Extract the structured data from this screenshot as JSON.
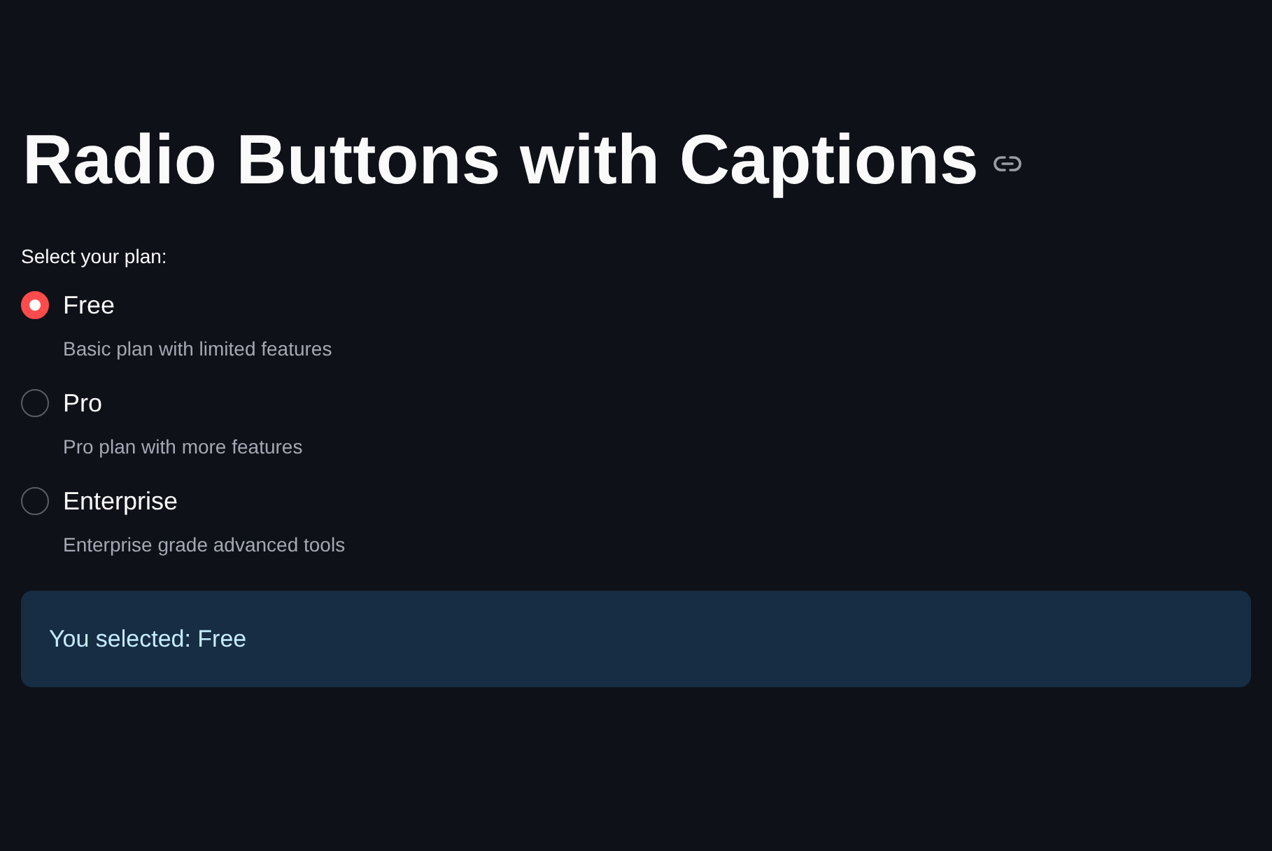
{
  "title": "Radio Buttons with Captions",
  "radio_group": {
    "label": "Select your plan:",
    "options": [
      {
        "label": "Free",
        "caption": "Basic plan with limited features",
        "selected": true
      },
      {
        "label": "Pro",
        "caption": "Pro plan with more features",
        "selected": false
      },
      {
        "label": "Enterprise",
        "caption": "Enterprise grade advanced tools",
        "selected": false
      }
    ]
  },
  "info_alert": {
    "text": "You selected: Free"
  }
}
